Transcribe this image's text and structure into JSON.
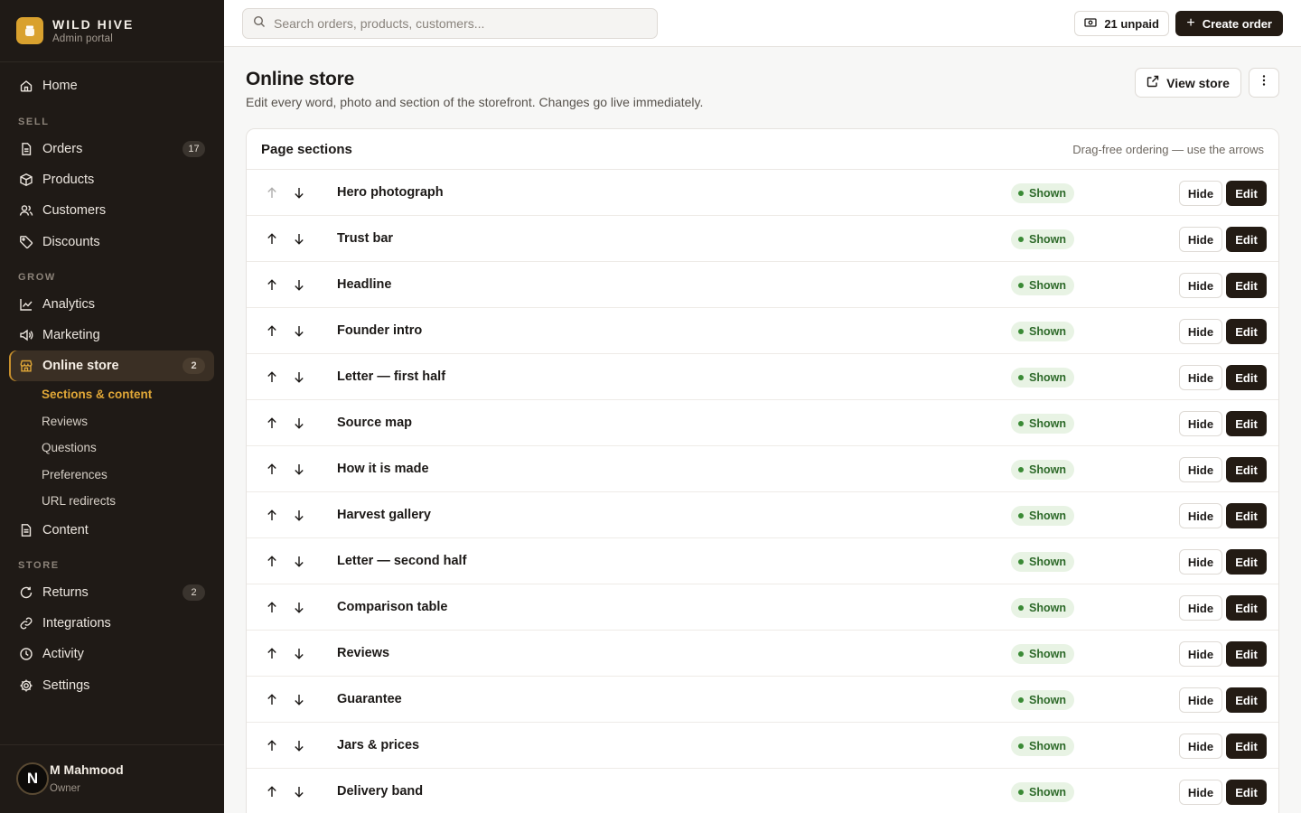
{
  "brand": {
    "name": "WILD HIVE",
    "subtitle": "Admin portal",
    "logo_icon": "honey-jar-icon",
    "accent": "#d9a12e"
  },
  "sidebar": {
    "top_items": [
      {
        "label": "Home",
        "icon": "home-icon"
      }
    ],
    "sections": [
      {
        "label": "SELL",
        "items": [
          {
            "label": "Orders",
            "icon": "orders-icon",
            "badge": "17"
          },
          {
            "label": "Products",
            "icon": "box-icon"
          },
          {
            "label": "Customers",
            "icon": "users-icon"
          },
          {
            "label": "Discounts",
            "icon": "tag-icon"
          }
        ]
      },
      {
        "label": "GROW",
        "items": [
          {
            "label": "Analytics",
            "icon": "chart-icon"
          },
          {
            "label": "Marketing",
            "icon": "megaphone-icon"
          },
          {
            "label": "Online store",
            "icon": "store-icon",
            "badge": "2",
            "active": true
          }
        ]
      },
      {
        "label": "STORE",
        "items": [
          {
            "label": "Returns",
            "icon": "refresh-icon",
            "badge": "2"
          },
          {
            "label": "Integrations",
            "icon": "link-icon"
          },
          {
            "label": "Activity",
            "icon": "clock-icon"
          },
          {
            "label": "Settings",
            "icon": "gear-icon"
          }
        ]
      }
    ],
    "online_store_subitems": [
      "Sections & content",
      "Reviews",
      "Questions",
      "Preferences",
      "URL redirects"
    ],
    "content_item": {
      "label": "Content",
      "icon": "document-icon"
    },
    "user": {
      "initial": "N",
      "name": "M Mahmood",
      "role": "Owner"
    }
  },
  "topbar": {
    "search_placeholder": "Search orders, products, customers...",
    "unpaid_label": "21 unpaid",
    "create_label": "Create order"
  },
  "page": {
    "title": "Online store",
    "subtitle": "Edit every word, photo and section of the storefront. Changes go live immediately.",
    "view_store_label": "View store"
  },
  "sections_card": {
    "title": "Page sections",
    "hint": "Drag-free ordering — use the arrows",
    "hide_label": "Hide",
    "edit_label": "Edit",
    "rows": [
      {
        "name": "Hero photograph",
        "status": "Shown"
      },
      {
        "name": "Trust bar",
        "status": "Shown"
      },
      {
        "name": "Headline",
        "status": "Shown"
      },
      {
        "name": "Founder intro",
        "status": "Shown"
      },
      {
        "name": "Letter — first half",
        "status": "Shown"
      },
      {
        "name": "Source map",
        "status": "Shown"
      },
      {
        "name": "How it is made",
        "status": "Shown"
      },
      {
        "name": "Harvest gallery",
        "status": "Shown"
      },
      {
        "name": "Letter — second half",
        "status": "Shown"
      },
      {
        "name": "Comparison table",
        "status": "Shown"
      },
      {
        "name": "Reviews",
        "status": "Shown"
      },
      {
        "name": "Guarantee",
        "status": "Shown"
      },
      {
        "name": "Jars & prices",
        "status": "Shown"
      },
      {
        "name": "Delivery band",
        "status": "Shown"
      }
    ]
  },
  "colors": {
    "sidebar_bg": "#1f1a16",
    "primary_button": "#231b14",
    "status_green": "#2e6a2a",
    "active_subitem": "#e0a737"
  }
}
